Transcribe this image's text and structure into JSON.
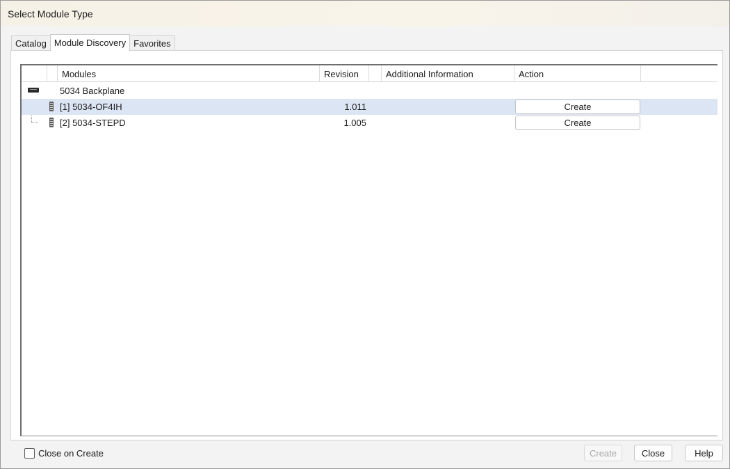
{
  "window": {
    "title": "Select Module Type"
  },
  "tabs": [
    {
      "label": "Catalog",
      "active": false
    },
    {
      "label": "Module Discovery",
      "active": true
    },
    {
      "label": "Favorites",
      "active": false
    }
  ],
  "table": {
    "columns": [
      "Modules",
      "Revision",
      "Additional Information",
      "Action"
    ],
    "rows": [
      {
        "module": "5034 Backplane",
        "revision": "",
        "info": "",
        "action": "",
        "icon": "backplane-icon"
      },
      {
        "module": "[1] 5034-OF4IH",
        "revision": "1.011",
        "info": "",
        "action": "Create",
        "icon": "module-icon",
        "selected": true
      },
      {
        "module": "[2] 5034-STEPD",
        "revision": "1.005",
        "info": "",
        "action": "Create",
        "icon": "module-icon"
      }
    ]
  },
  "footer": {
    "close_on_create_label": "Close on Create",
    "close_on_create_checked": false,
    "create_label": "Create",
    "close_label": "Close",
    "help_label": "Help"
  },
  "colors": {
    "selected_row": "#dbe5f4",
    "title_bar": "#f6f1e6"
  }
}
